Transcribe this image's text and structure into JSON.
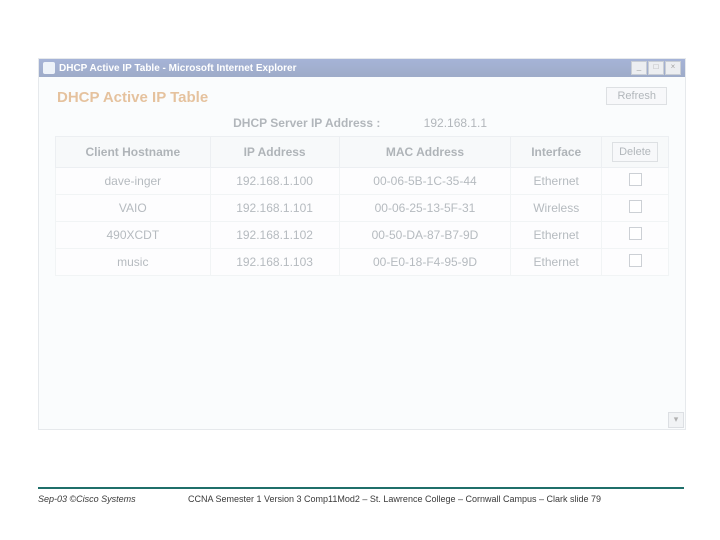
{
  "window": {
    "title": "DHCP Active IP Table - Microsoft Internet Explorer",
    "controls": {
      "min": "_",
      "max": "□",
      "close": "×"
    }
  },
  "page": {
    "title": "DHCP Active IP Table",
    "refresh_label": "Refresh",
    "server_label": "DHCP Server IP Address :",
    "server_value": "192.168.1.1"
  },
  "table": {
    "headers": {
      "hostname": "Client Hostname",
      "ip": "IP Address",
      "mac": "MAC Address",
      "iface": "Interface",
      "delete": "Delete"
    },
    "rows": [
      {
        "hostname": "dave-inger",
        "ip": "192.168.1.100",
        "mac": "00-06-5B-1C-35-44",
        "iface": "Ethernet"
      },
      {
        "hostname": "VAIO",
        "ip": "192.168.1.101",
        "mac": "00-06-25-13-5F-31",
        "iface": "Wireless"
      },
      {
        "hostname": "490XCDT",
        "ip": "192.168.1.102",
        "mac": "00-50-DA-87-B7-9D",
        "iface": "Ethernet"
      },
      {
        "hostname": "music",
        "ip": "192.168.1.103",
        "mac": "00-E0-18-F4-95-9D",
        "iface": "Ethernet"
      }
    ]
  },
  "footer": {
    "left": "Sep-03 ©Cisco Systems",
    "right": "CCNA Semester 1 Version 3 Comp11Mod2 – St. Lawrence College – Cornwall Campus – Clark slide 79"
  }
}
